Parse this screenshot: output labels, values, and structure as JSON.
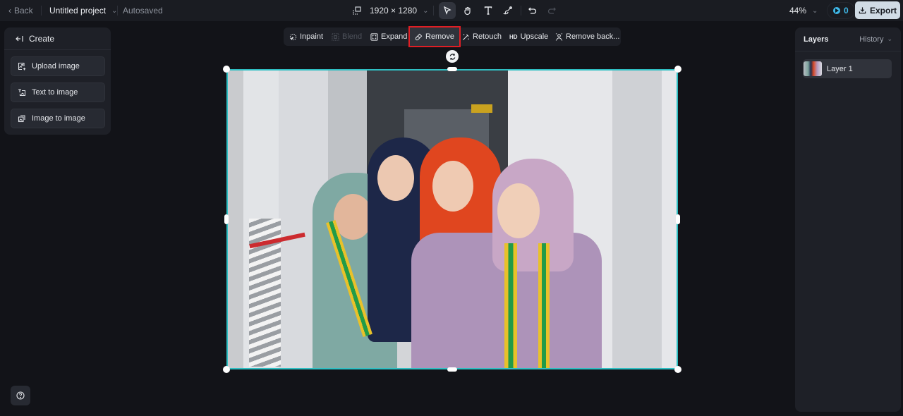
{
  "topbar": {
    "back_label": "Back",
    "project_name": "Untitled project",
    "save_status": "Autosaved",
    "canvas_size": "1920 × 1280",
    "zoom_level": "44%",
    "credits": "0",
    "export_label": "Export",
    "tools": [
      {
        "name": "select-tool",
        "icon": "cursor-arrow-icon",
        "active": true
      },
      {
        "name": "hand-tool",
        "icon": "hand-icon",
        "active": false
      },
      {
        "name": "text-tool",
        "icon": "text-icon",
        "active": false
      },
      {
        "name": "brush-tool",
        "icon": "brush-icon",
        "active": false
      },
      {
        "name": "undo",
        "icon": "undo-icon",
        "enabled": true
      },
      {
        "name": "redo",
        "icon": "redo-icon",
        "enabled": false
      }
    ]
  },
  "left_panel": {
    "title": "Create",
    "items": [
      {
        "label": "Upload image",
        "icon": "upload-image-icon"
      },
      {
        "label": "Text to image",
        "icon": "text-to-image-icon"
      },
      {
        "label": "Image to image",
        "icon": "image-to-image-icon"
      }
    ]
  },
  "context_toolbar": {
    "items": [
      {
        "label": "Inpaint",
        "icon": "inpaint-icon",
        "enabled": true
      },
      {
        "label": "Blend",
        "icon": "blend-icon",
        "enabled": false
      },
      {
        "label": "Expand",
        "icon": "expand-icon",
        "enabled": true
      },
      {
        "label": "Remove",
        "icon": "eraser-icon",
        "enabled": true,
        "highlighted": true
      },
      {
        "label": "Retouch",
        "icon": "magic-wand-icon",
        "enabled": true
      },
      {
        "label": "Upscale",
        "icon": "hd-icon",
        "icon_text": "HD",
        "enabled": true
      },
      {
        "label": "Remove back...",
        "icon": "remove-background-icon",
        "enabled": true
      }
    ]
  },
  "right_panel": {
    "title": "Layers",
    "history_label": "History",
    "layers": [
      {
        "name": "Layer 1",
        "selected": true
      }
    ]
  },
  "canvas": {
    "image_description": "Four women in colorful hijabs (teal, navy, orange-red, lilac) wearing green and yellow graduation sashes, posing in a white corridor",
    "selection_color": "#2fbfc3",
    "highlight_color": "#e01e24"
  }
}
